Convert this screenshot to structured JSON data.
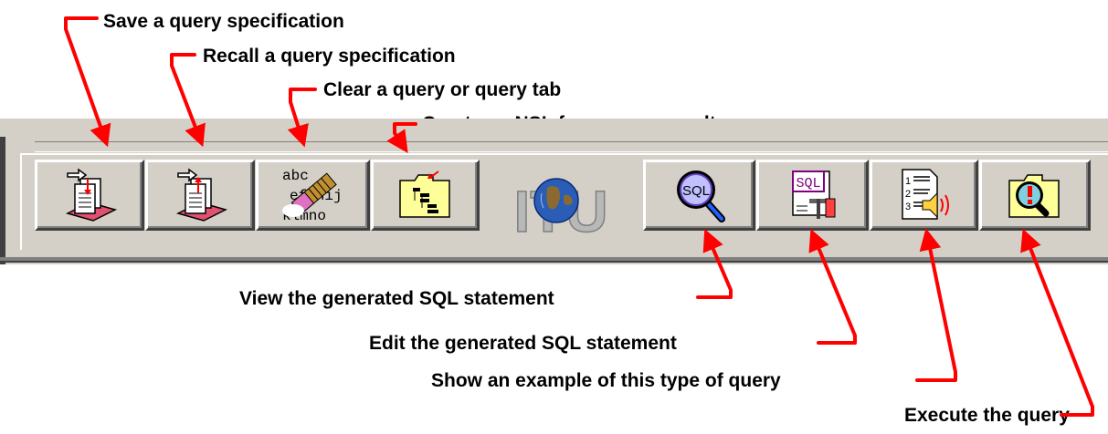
{
  "callouts": {
    "save": "Save a query specification",
    "recall": "Recall a query specification",
    "clear": "Clear a query or query tab",
    "nsl": "Create an NSL from query results",
    "view_sql": "View the generated SQL statement",
    "edit_sql": "Edit the generated SQL statement",
    "example": "Show an example of this type of query",
    "execute": "Execute the query"
  },
  "toolbar": {
    "buttons": [
      {
        "name": "save-query-button",
        "icon": "save-query-icon"
      },
      {
        "name": "recall-query-button",
        "icon": "recall-query-icon"
      },
      {
        "name": "clear-query-button",
        "icon": "eraser-icon"
      },
      {
        "name": "create-nsl-button",
        "icon": "folder-list-icon"
      },
      {
        "name": "view-sql-button",
        "icon": "sql-magnifier-icon"
      },
      {
        "name": "edit-sql-button",
        "icon": "sql-edit-icon"
      },
      {
        "name": "example-query-button",
        "icon": "example-speaker-icon"
      },
      {
        "name": "execute-query-button",
        "icon": "folder-search-icon"
      }
    ],
    "eraser_text": {
      "line1": "abc",
      "line2": "efghij",
      "line3": "klmno"
    },
    "sql_badge": "SQL",
    "list_numbers": {
      "n1": "1",
      "n2": "2",
      "n3": "3"
    },
    "logo_text": "ITU",
    "colors": {
      "arrow": "#ff0000",
      "face": "#d4d0c8",
      "folder": "#ffff99"
    }
  }
}
